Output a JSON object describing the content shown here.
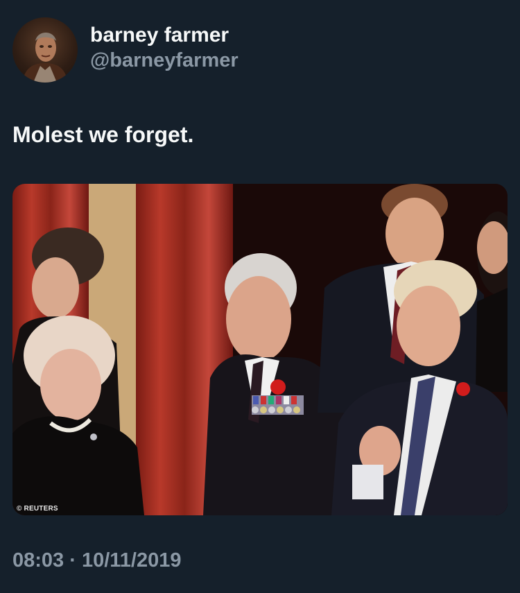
{
  "author": {
    "display_name": "barney farmer",
    "handle": "@barneyfarmer"
  },
  "tweet": {
    "text": "Molest we forget.",
    "timestamp": "08:03 · 10/11/2019"
  },
  "media": {
    "credit": "© REUTERS"
  },
  "colors": {
    "background": "#15202b",
    "primary_text": "#f7f9f9",
    "secondary_text": "#8b98a5"
  }
}
